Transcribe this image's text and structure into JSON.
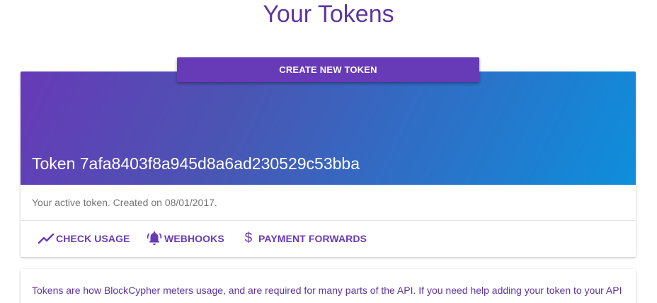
{
  "page": {
    "title": "Your Tokens"
  },
  "create_button": {
    "label": "CREATE NEW TOKEN"
  },
  "token_card": {
    "token_title": "Token 7afa8403f8a945d8a6ad230529c53bba",
    "subtitle": "Your active token. Created on 08/01/2017.",
    "actions": [
      {
        "label": "CHECK USAGE",
        "icon": "trending-up-icon"
      },
      {
        "label": "WEBHOOKS",
        "icon": "bell-ring-icon"
      },
      {
        "label": "PAYMENT FORWARDS",
        "icon": "dollar-icon",
        "glyph": "$"
      }
    ]
  },
  "info_card": {
    "text": "Tokens are how BlockCypher meters usage, and are required for many parts of the API. If you need help adding your token to your API"
  },
  "colors": {
    "accent": "#673ab7",
    "title": "#5e35a0",
    "gradient_start": "#673ab7",
    "gradient_end": "#0d8fdc"
  }
}
